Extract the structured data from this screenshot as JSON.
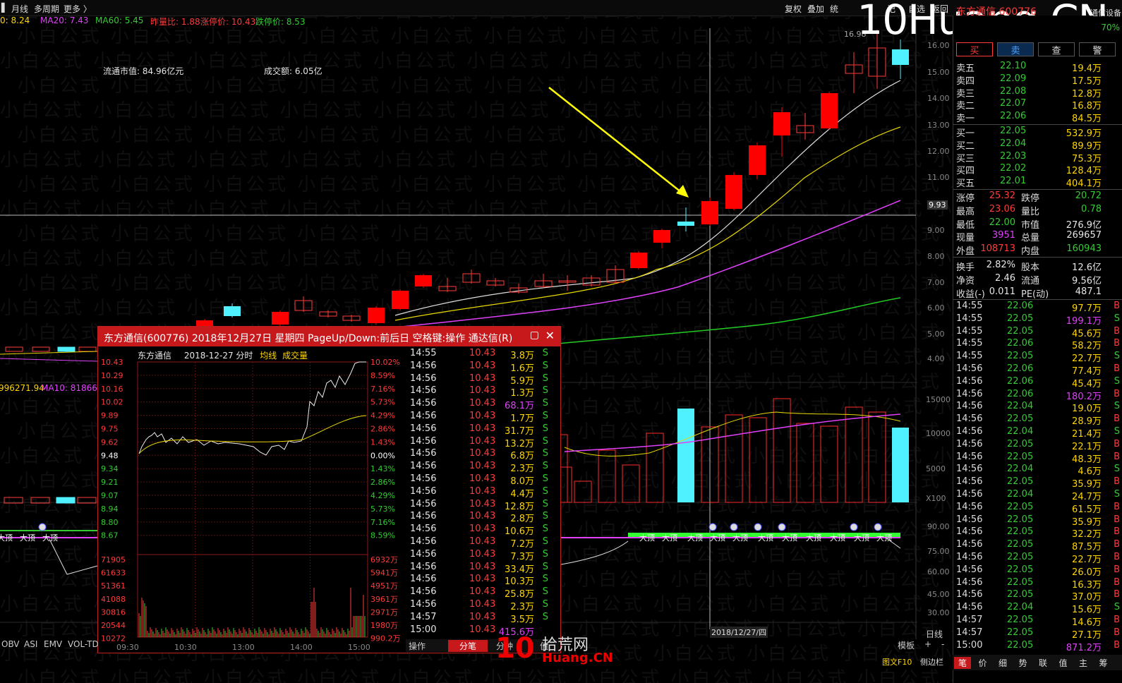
{
  "topbar": {
    "left_items": [
      "月线",
      "多周期",
      "更多 〉"
    ],
    "right_items": [
      "复权",
      "叠加",
      "统",
      "记",
      "自选",
      "返回"
    ]
  },
  "logo": "10Huang.CN",
  "ma_line": [
    {
      "text": "0: 8.24",
      "color": "#ffd600"
    },
    {
      "text": "MA20: 7.43",
      "color": "#e040fb"
    },
    {
      "text": "MA60: 5.45",
      "color": "#33cc33"
    },
    {
      "text": "昨量比: 1.88",
      "color": "#ff3b3b"
    },
    {
      "text": "涨停价: 10.43",
      "color": "#ff3b3b"
    },
    {
      "text": "跌停价: 8.53",
      "color": "#33cc33"
    }
  ],
  "info": {
    "ltsz": "流通市值: 84.96亿元",
    "cje": "成交额: 6.05亿"
  },
  "main_axis": [
    "16.00",
    "15.00",
    "14.00",
    "13.00",
    "12.00",
    "11.00",
    "9.93",
    "9.00",
    "8.00",
    "7.00",
    "6.00",
    "5.00",
    "4.00"
  ],
  "crosshair_price": "9.93",
  "peak_label": "16.98",
  "vol_axis": [
    "15000",
    "10000",
    "5000",
    "X100"
  ],
  "ind_axis": [
    "90.00",
    "75.00",
    "60.00",
    "45.00",
    "30.00"
  ],
  "left_vol_label": "996271.94",
  "left_ma10": "MA10: 818665",
  "date_label": "2018/12/27/四",
  "day_label": "日线",
  "tabs_bottom": [
    "OBV",
    "ASI",
    "EMV",
    "VOL-TD"
  ],
  "right_bottom": [
    "模板",
    "+",
    "-"
  ],
  "dafeng": "大顶",
  "popup": {
    "title": "东方通信(600776) 2018年12月27日 星期四 PageUp/Down:前后日 空格键:操作 通达信(R)",
    "sub_name": "东方通信",
    "sub_date": "2018-12-27 分时",
    "sub_jx": "均线",
    "sub_cjl": "成交量",
    "left_prices": [
      "10.43",
      "10.29",
      "10.16",
      "10.02",
      "9.89",
      "9.75",
      "9.62",
      "9.48",
      "9.34",
      "9.21",
      "9.07",
      "8.94",
      "8.80",
      "8.67"
    ],
    "right_pcts": [
      "10.02%",
      "8.59%",
      "7.16%",
      "5.73%",
      "4.29%",
      "2.86%",
      "1.43%",
      "0.00%",
      "1.43%",
      "2.86%",
      "4.29%",
      "5.73%",
      "7.16%",
      "8.59%"
    ],
    "left_vols": [
      "71905",
      "61633",
      "51361",
      "41088",
      "30816",
      "20544",
      "10272"
    ],
    "right_vols": [
      "6932万",
      "5941万",
      "4951万",
      "3961万",
      "2971万",
      "1980万",
      "990.2万"
    ],
    "times": [
      "09:30",
      "10:30",
      "13:00",
      "14:00",
      "15:00"
    ],
    "ticks": [
      {
        "t": "14:55",
        "p": "10.43",
        "v": "3.8万",
        "s": "S"
      },
      {
        "t": "14:56",
        "p": "10.43",
        "v": "1.6万",
        "s": "S"
      },
      {
        "t": "14:56",
        "p": "10.43",
        "v": "5.9万",
        "s": "S"
      },
      {
        "t": "14:56",
        "p": "10.43",
        "v": "1.3万",
        "s": "S"
      },
      {
        "t": "14:56",
        "p": "10.43",
        "v": "68.1万",
        "s": "S"
      },
      {
        "t": "14:56",
        "p": "10.43",
        "v": "1.7万",
        "s": "S"
      },
      {
        "t": "14:56",
        "p": "10.43",
        "v": "31.7万",
        "s": "S"
      },
      {
        "t": "14:56",
        "p": "10.43",
        "v": "13.2万",
        "s": "S"
      },
      {
        "t": "14:56",
        "p": "10.43",
        "v": "6.8万",
        "s": "S"
      },
      {
        "t": "14:56",
        "p": "10.43",
        "v": "2.3万",
        "s": "S"
      },
      {
        "t": "14:56",
        "p": "10.43",
        "v": "8.0万",
        "s": "S"
      },
      {
        "t": "14:56",
        "p": "10.43",
        "v": "4.4万",
        "s": "S"
      },
      {
        "t": "14:56",
        "p": "10.43",
        "v": "12.8万",
        "s": "S"
      },
      {
        "t": "14:56",
        "p": "10.43",
        "v": "2.8万",
        "s": "S"
      },
      {
        "t": "14:56",
        "p": "10.43",
        "v": "10.6万",
        "s": "S"
      },
      {
        "t": "14:56",
        "p": "10.43",
        "v": "7.2万",
        "s": "S"
      },
      {
        "t": "14:56",
        "p": "10.43",
        "v": "7.3万",
        "s": "S"
      },
      {
        "t": "14:56",
        "p": "10.43",
        "v": "33.4万",
        "s": "S"
      },
      {
        "t": "14:56",
        "p": "10.43",
        "v": "10.3万",
        "s": "S"
      },
      {
        "t": "14:56",
        "p": "10.43",
        "v": "25.8万",
        "s": "S"
      },
      {
        "t": "14:56",
        "p": "10.43",
        "v": "2.3万",
        "s": "S"
      },
      {
        "t": "14:57",
        "p": "10.43",
        "v": "3.5万",
        "s": "S"
      },
      {
        "t": "15:00",
        "p": "10.43",
        "v": "415.6万",
        "s": ""
      }
    ],
    "bottom_tabs": [
      "操作",
      "分笔",
      "分钟",
      "值"
    ]
  },
  "right": {
    "title": "东方通信 600776",
    "subtitle": "通信设备",
    "pct_partial": "70%",
    "buttons": [
      "买",
      "卖",
      "查",
      "警"
    ],
    "asks": [
      {
        "l": "卖五",
        "p": "22.10",
        "v": "19.4万"
      },
      {
        "l": "卖四",
        "p": "22.09",
        "v": "17.5万"
      },
      {
        "l": "卖三",
        "p": "22.08",
        "v": "12.8万"
      },
      {
        "l": "卖二",
        "p": "22.07",
        "v": "16.8万"
      },
      {
        "l": "卖一",
        "p": "22.06",
        "v": "84.5万"
      }
    ],
    "bids": [
      {
        "l": "买一",
        "p": "22.05",
        "v": "532.9万"
      },
      {
        "l": "买二",
        "p": "22.04",
        "v": "89.9万"
      },
      {
        "l": "买三",
        "p": "22.03",
        "v": "75.3万"
      },
      {
        "l": "买四",
        "p": "22.02",
        "v": "128.4万"
      },
      {
        "l": "买五",
        "p": "22.01",
        "v": "404.1万"
      }
    ],
    "stats": [
      {
        "l1": "涨停",
        "v1": "25.32",
        "c1": "#ff3b3b",
        "l2": "跌停",
        "v2": "20.72",
        "c2": "#33cc33"
      },
      {
        "l1": "最高",
        "v1": "23.06",
        "c1": "#ff3b3b",
        "l2": "量比",
        "v2": "0.78",
        "c2": "#33cc33"
      },
      {
        "l1": "最低",
        "v1": "22.00",
        "c1": "#33cc33",
        "l2": "市值",
        "v2": "276.9亿",
        "c2": "#e6e6e6"
      },
      {
        "l1": "现量",
        "v1": "3951",
        "c1": "#e040fb",
        "l2": "总量",
        "v2": "269657",
        "c2": "#e6e6e6"
      },
      {
        "l1": "外盘",
        "v1": "108713",
        "c1": "#ff3b3b",
        "l2": "内盘",
        "v2": "160943",
        "c2": "#33cc33"
      },
      {
        "l1": "换手",
        "v1": "2.82%",
        "c1": "#e6e6e6",
        "l2": "股本",
        "v2": "12.6亿",
        "c2": "#e6e6e6"
      },
      {
        "l1": "净资",
        "v1": "2.46",
        "c1": "#e6e6e6",
        "l2": "流通",
        "v2": "9.56亿",
        "c2": "#e6e6e6"
      },
      {
        "l1": "收益(-)",
        "v1": "0.011",
        "c1": "#e6e6e6",
        "l2": "PE(动)",
        "v2": "487.1",
        "c2": "#e6e6e6"
      }
    ],
    "ticks": [
      {
        "t": "14:55",
        "p": "22.06",
        "v": "97.7万",
        "s": "B",
        "pc": "#33cc33",
        "vc": "#ffd600"
      },
      {
        "t": "14:55",
        "p": "22.05",
        "v": "199.1万",
        "s": "S",
        "pc": "#33cc33",
        "vc": "#e040fb"
      },
      {
        "t": "14:55",
        "p": "22.05",
        "v": "45.6万",
        "s": "B",
        "pc": "#33cc33",
        "vc": "#ffd600"
      },
      {
        "t": "14:55",
        "p": "22.06",
        "v": "58.2万",
        "s": "B",
        "pc": "#33cc33",
        "vc": "#ffd600"
      },
      {
        "t": "14:55",
        "p": "22.05",
        "v": "22.7万",
        "s": "S",
        "pc": "#33cc33",
        "vc": "#ffd600"
      },
      {
        "t": "14:56",
        "p": "22.06",
        "v": "77.4万",
        "s": "B",
        "pc": "#33cc33",
        "vc": "#ffd600"
      },
      {
        "t": "14:56",
        "p": "22.06",
        "v": "45.4万",
        "s": "S",
        "pc": "#33cc33",
        "vc": "#ffd600"
      },
      {
        "t": "14:56",
        "p": "22.06",
        "v": "180.2万",
        "s": "B",
        "pc": "#33cc33",
        "vc": "#e040fb"
      },
      {
        "t": "14:56",
        "p": "22.04",
        "v": "19.0万",
        "s": "S",
        "pc": "#33cc33",
        "vc": "#ffd600"
      },
      {
        "t": "14:56",
        "p": "22.05",
        "v": "28.9万",
        "s": "B",
        "pc": "#33cc33",
        "vc": "#ffd600"
      },
      {
        "t": "14:56",
        "p": "22.04",
        "v": "21.4万",
        "s": "S",
        "pc": "#33cc33",
        "vc": "#ffd600"
      },
      {
        "t": "14:56",
        "p": "22.05",
        "v": "22.1万",
        "s": "B",
        "pc": "#33cc33",
        "vc": "#ffd600"
      },
      {
        "t": "14:56",
        "p": "22.05",
        "v": "48.3万",
        "s": "B",
        "pc": "#33cc33",
        "vc": "#ffd600"
      },
      {
        "t": "14:56",
        "p": "22.04",
        "v": "4.6万",
        "s": "S",
        "pc": "#33cc33",
        "vc": "#ffd600"
      },
      {
        "t": "14:56",
        "p": "22.05",
        "v": "35.9万",
        "s": "B",
        "pc": "#33cc33",
        "vc": "#ffd600"
      },
      {
        "t": "14:56",
        "p": "22.04",
        "v": "24.7万",
        "s": "S",
        "pc": "#33cc33",
        "vc": "#ffd600"
      },
      {
        "t": "14:56",
        "p": "22.05",
        "v": "61.5万",
        "s": "B",
        "pc": "#33cc33",
        "vc": "#ffd600"
      },
      {
        "t": "14:56",
        "p": "22.05",
        "v": "35.9万",
        "s": "B",
        "pc": "#33cc33",
        "vc": "#ffd600"
      },
      {
        "t": "14:56",
        "p": "22.05",
        "v": "32.2万",
        "s": "B",
        "pc": "#33cc33",
        "vc": "#ffd600"
      },
      {
        "t": "14:56",
        "p": "22.05",
        "v": "87.5万",
        "s": "B",
        "pc": "#33cc33",
        "vc": "#ffd600"
      },
      {
        "t": "14:56",
        "p": "22.05",
        "v": "22.7万",
        "s": "B",
        "pc": "#33cc33",
        "vc": "#ffd600"
      },
      {
        "t": "14:56",
        "p": "22.05",
        "v": "26.0万",
        "s": "B",
        "pc": "#33cc33",
        "vc": "#ffd600"
      },
      {
        "t": "14:56",
        "p": "22.05",
        "v": "16.3万",
        "s": "B",
        "pc": "#33cc33",
        "vc": "#ffd600"
      },
      {
        "t": "14:56",
        "p": "22.05",
        "v": "37.0万",
        "s": "B",
        "pc": "#33cc33",
        "vc": "#ffd600"
      },
      {
        "t": "14:56",
        "p": "22.04",
        "v": "15.6万",
        "s": "S",
        "pc": "#33cc33",
        "vc": "#ffd600"
      },
      {
        "t": "14:57",
        "p": "22.05",
        "v": "14.6万",
        "s": "B",
        "pc": "#33cc33",
        "vc": "#ffd600"
      },
      {
        "t": "14:57",
        "p": "22.05",
        "v": "27.1万",
        "s": "B",
        "pc": "#33cc33",
        "vc": "#ffd600"
      },
      {
        "t": "15:00",
        "p": "22.05",
        "v": "871.2万",
        "s": "B",
        "pc": "#33cc33",
        "vc": "#e040fb"
      }
    ],
    "bottom_tabs": [
      "笔",
      "价",
      "细",
      "势",
      "联",
      "值",
      "主",
      "筹"
    ],
    "f10": "图文F10",
    "side": "侧边栏"
  },
  "brand_bottom": {
    "num": "10",
    "cn": "拾荒网",
    "en": "Huang.CN"
  }
}
